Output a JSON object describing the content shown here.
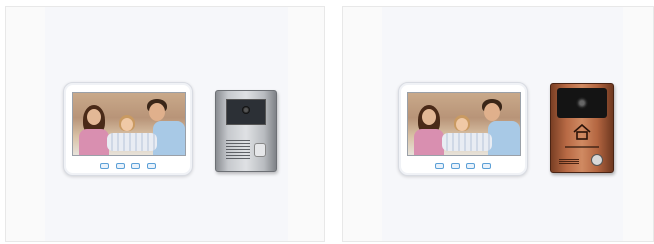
{
  "products": [
    {
      "name": "",
      "monitor": {
        "buttons": [
          "menu-icon",
          "wifi-icon",
          "home-icon",
          "back-icon"
        ]
      },
      "door_camera": {
        "finish": "silver",
        "color": "#c6c9cd"
      }
    },
    {
      "name": "",
      "monitor": {
        "buttons": [
          "menu-icon",
          "wifi-icon",
          "home-icon",
          "back-icon"
        ]
      },
      "door_camera": {
        "finish": "bronze",
        "color": "#b86a45"
      }
    }
  ],
  "colors": {
    "monitor_button_border": "#5b9fd6",
    "card_background": "#f6f7fa"
  }
}
